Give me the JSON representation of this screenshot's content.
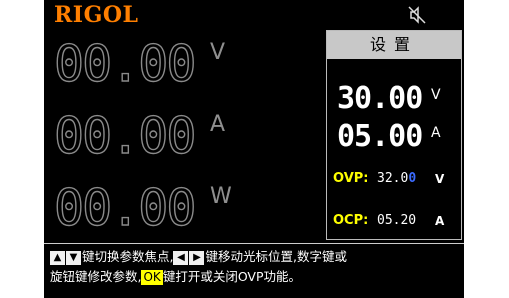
{
  "header": {
    "brand": "RIGOL",
    "status_icon": "sound-off-icon"
  },
  "measurements": [
    {
      "value": "00.00",
      "unit": "V"
    },
    {
      "value": "00.00",
      "unit": "A"
    },
    {
      "value": "00.00",
      "unit": "W"
    }
  ],
  "settings": {
    "title": "设置",
    "voltage": {
      "value": "30.00",
      "unit": "V"
    },
    "current": {
      "value": "05.00",
      "unit": "A"
    },
    "ovp": {
      "label": "OVP:",
      "value_prefix": "32.0",
      "value_cursor": "0",
      "unit": "V"
    },
    "ocp": {
      "label": "OCP:",
      "value": "05.20",
      "unit": "A"
    }
  },
  "help": {
    "up_key": "▲",
    "down_key": "▼",
    "text1": "键切换参数焦点,",
    "left_key": "◀",
    "right_key": "▶",
    "text2": "键移动光标位置,数字键或",
    "text3": "旋钮键修改参数,",
    "ok_key": "OK",
    "text4": "键打开或关闭OVP功能。"
  },
  "colors": {
    "brand": "#ff7f00",
    "protection_label": "#ffff00",
    "cursor_digit": "#3b6bff",
    "ok_key": "#ffff00"
  }
}
